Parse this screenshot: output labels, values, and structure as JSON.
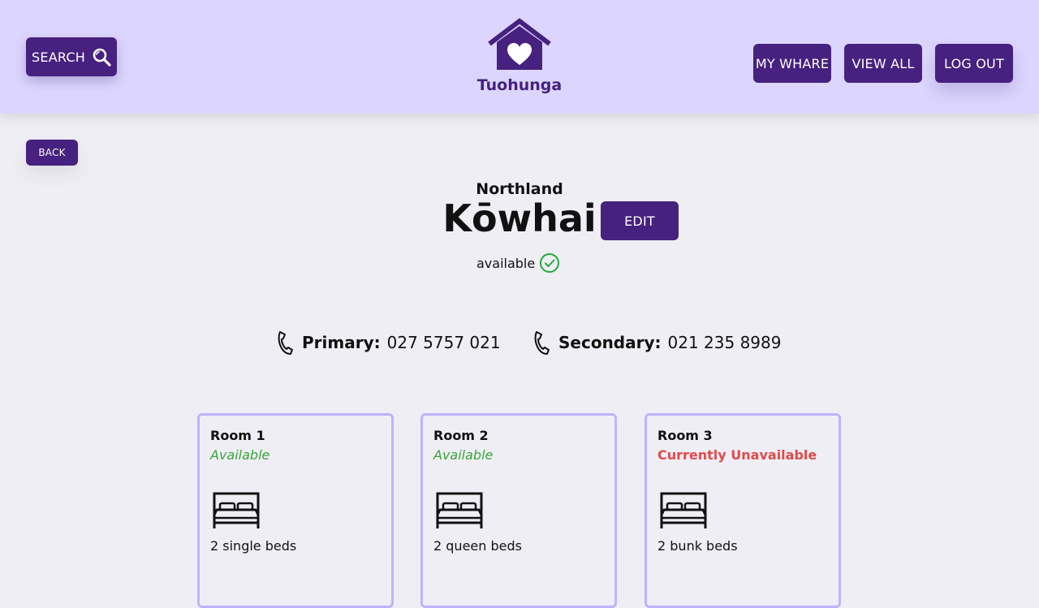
{
  "header": {
    "search_label": "SEARCH",
    "logo_text": "Tuohunga",
    "nav": [
      "MY WHARE",
      "VIEW ALL",
      "LOG OUT"
    ]
  },
  "back_label": "BACK",
  "whare": {
    "region": "Northland",
    "name": "Kōwhai",
    "edit_label": "EDIT",
    "status": "available"
  },
  "contacts": {
    "primary_label": "Primary:",
    "primary_number": "027 5757 021",
    "secondary_label": "Secondary:",
    "secondary_number": "021 235 8989"
  },
  "rooms": [
    {
      "name": "Room 1",
      "status": "Available",
      "beds": "2 single beds"
    },
    {
      "name": "Room 2",
      "status": "Available",
      "beds": "2 queen beds"
    },
    {
      "name": "Room 3",
      "status": "Currently Unavailable",
      "beds": "2 bunk beds"
    }
  ],
  "colors": {
    "accent": "#46217f",
    "header_bg": "#dcd6ff",
    "card_border": "#bfb3ff",
    "available": "#3aa53a",
    "unavailable": "#e04b4b"
  },
  "icons": [
    "search-icon",
    "house-heart-logo-icon",
    "check-circle-icon",
    "phone-icon",
    "bed-icon"
  ]
}
